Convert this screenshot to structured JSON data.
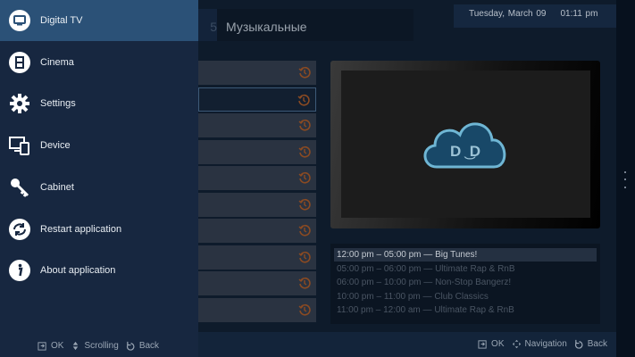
{
  "header": {
    "tabs": [
      {
        "label": "5"
      },
      {
        "label": "Музыкальные"
      }
    ],
    "date": "Tuesday, March 09",
    "time": "01:11 pm"
  },
  "sidebar": {
    "items": [
      {
        "label": "Digital TV",
        "icon": "tv-icon",
        "active": true
      },
      {
        "label": "Cinema",
        "icon": "film-icon"
      },
      {
        "label": "Settings",
        "icon": "gear-icon"
      },
      {
        "label": "Device",
        "icon": "devices-icon"
      },
      {
        "label": "Cabinet",
        "icon": "key-icon"
      },
      {
        "label": "Restart application",
        "icon": "restart-icon"
      },
      {
        "label": "About application",
        "icon": "info-icon"
      }
    ],
    "footer": {
      "ok": "OK",
      "scroll": "Scrolling",
      "back": "Back"
    }
  },
  "channels": {
    "count_rows": 10,
    "selected_index": 1,
    "icon": "history-icon",
    "icon_color": "#8a4a22"
  },
  "player": {
    "logo_text": "D.D"
  },
  "schedule": [
    {
      "text": "12:00 pm – 05:00 pm  —  Big Tunes!",
      "current": true
    },
    {
      "text": "05:00 pm – 06:00 pm  —  Ultimate Rap & RnB"
    },
    {
      "text": "06:00 pm – 10:00 pm  —  Non-Stop Bangerz!"
    },
    {
      "text": "10:00 pm – 11:00 pm  —  Club Classics"
    },
    {
      "text": "11:00 pm – 12:00 am  —  Ultimate Rap & RnB"
    }
  ],
  "footer": {
    "ok": "OK",
    "nav": "Navigation",
    "back": "Back"
  },
  "colors": {
    "sidebar_active": "#2b5177",
    "sidebar_bg": "#172740",
    "accent_orange": "#8a4a22"
  }
}
